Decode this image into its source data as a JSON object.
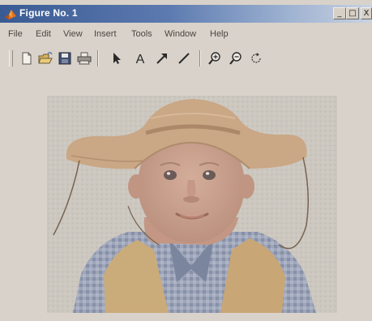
{
  "window": {
    "title": "Figure No. 1",
    "controls": {
      "minimize": "_",
      "maximize": "□",
      "close": "X"
    }
  },
  "menu": [
    "File",
    "Edit",
    "View",
    "Insert",
    "Tools",
    "Window",
    "Help"
  ],
  "toolbar": {
    "buttons": [
      {
        "name": "new-figure",
        "icon": "new-document-icon"
      },
      {
        "name": "open-file",
        "icon": "folder-open-icon"
      },
      {
        "name": "save-figure",
        "icon": "floppy-disk-icon"
      },
      {
        "name": "print-figure",
        "icon": "printer-icon"
      },
      {
        "name": "edit-plot",
        "icon": "arrow-pointer-icon"
      },
      {
        "name": "insert-text",
        "icon": "text-A-icon"
      },
      {
        "name": "insert-arrow",
        "icon": "diagonal-arrow-icon"
      },
      {
        "name": "insert-line",
        "icon": "diagonal-line-icon"
      },
      {
        "name": "zoom-in",
        "icon": "zoom-in-icon"
      },
      {
        "name": "zoom-out",
        "icon": "zoom-out-icon"
      },
      {
        "name": "rotate-3d",
        "icon": "rotate-icon"
      }
    ],
    "text_glyph": "A"
  },
  "figure": {
    "image": "photo of a baby wearing a straw cowboy hat, tan vest and blue checked shirt",
    "colors": {
      "background": "#d8d2ca",
      "photo_backdrop": "#c9c4bd",
      "hat": "#c9a17c",
      "skin": "#c79a85",
      "vest": "#c9a56f",
      "shirt": "#8e97b0"
    }
  }
}
